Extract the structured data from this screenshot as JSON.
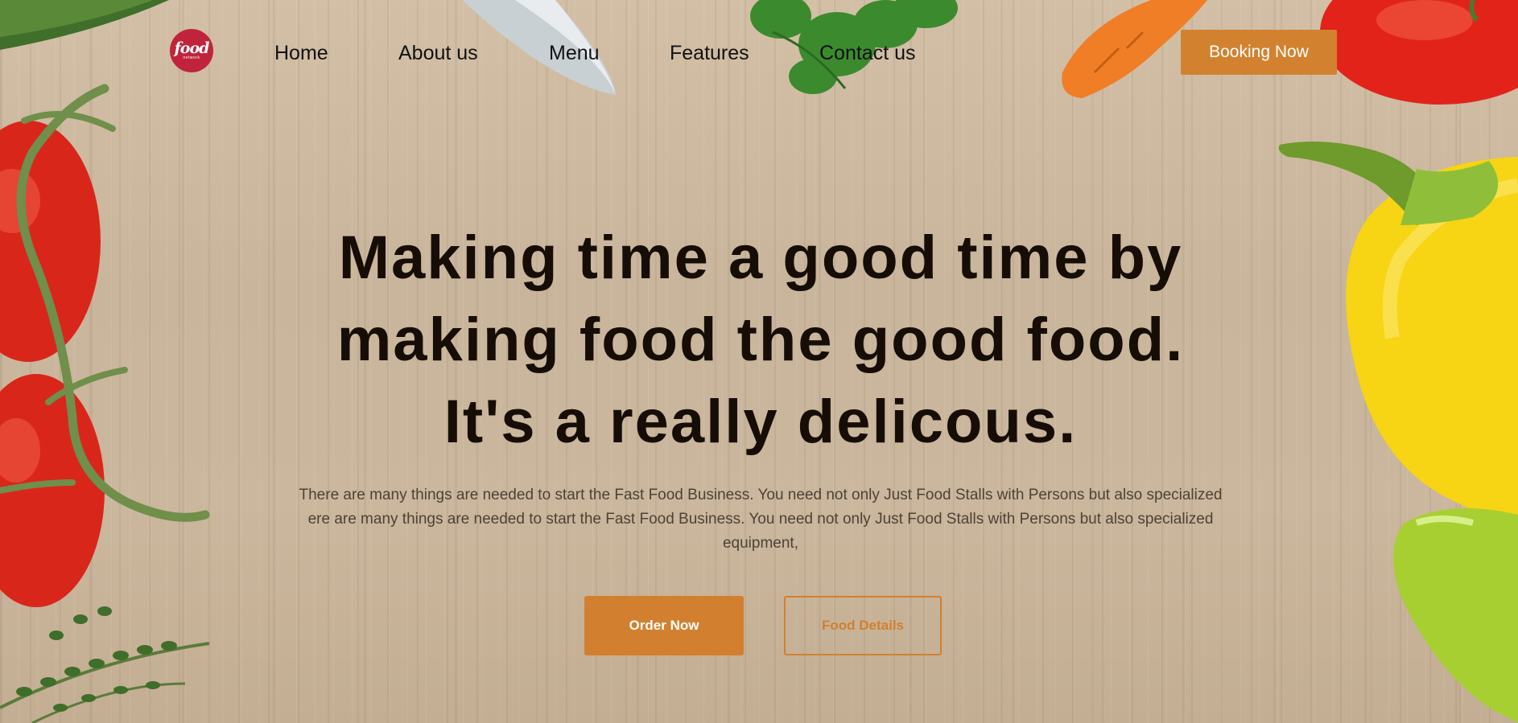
{
  "brand": {
    "logo_word": "food",
    "logo_sub": "network",
    "accent": "#d2802f",
    "logo_color": "#c0243c"
  },
  "nav": {
    "items": [
      "Home",
      "About us",
      "Menu",
      "Features",
      "Contact us"
    ],
    "booking_label": "Booking Now"
  },
  "hero": {
    "title_lines": [
      "Making time a good time by",
      "making food the good food.",
      "It's a really delicous."
    ],
    "description": "There are many things are needed to start the Fast Food Business. You need not only Just Food Stalls with Persons but also specialized ere are many things are needed to start the Fast Food Business. You need not only Just Food Stalls with Persons but also specialized equipment,",
    "order_label": "Order Now",
    "details_label": "Food Details"
  },
  "decor_icons": [
    "knife-icon",
    "parsley-icon",
    "carrot-icon",
    "tomato-icon",
    "bell-pepper-icon",
    "cucumber-icon",
    "thyme-icon"
  ]
}
